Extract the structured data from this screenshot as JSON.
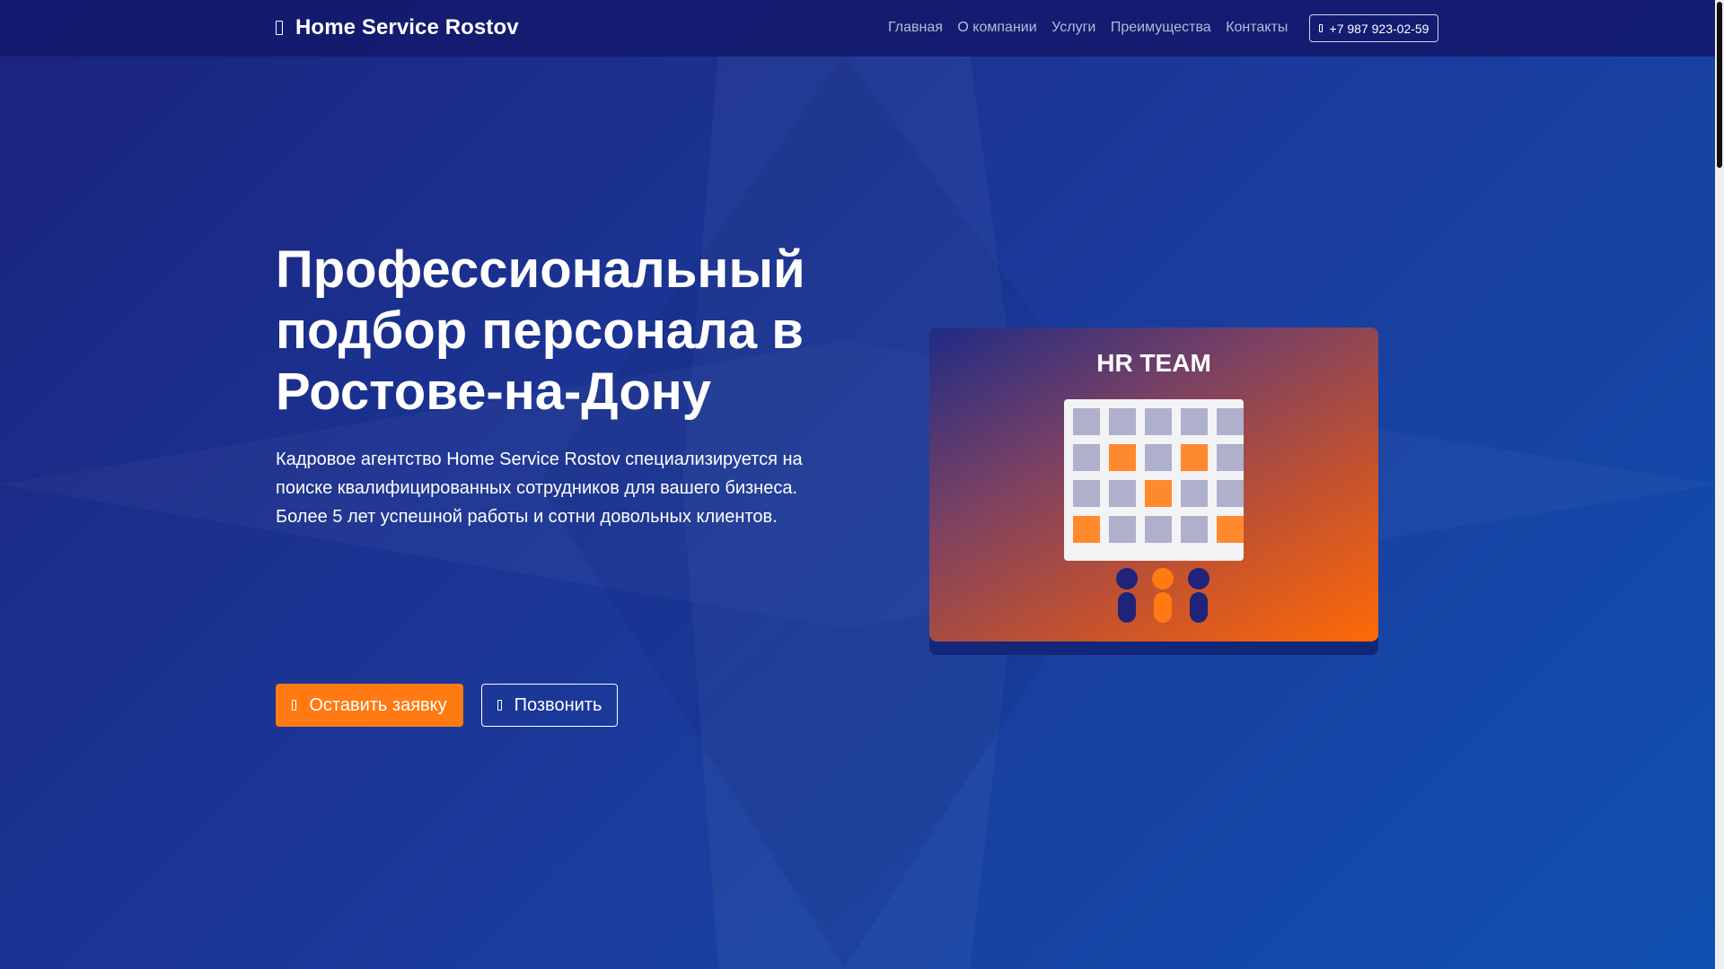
{
  "brand": {
    "name": "Home Service Rostov",
    "icon": "phone-icon"
  },
  "nav": {
    "links": [
      "Главная",
      "О компании",
      "Услуги",
      "Преимущества",
      "Контакты"
    ],
    "phone": "+7 987 923-02-59",
    "phone_icon": "phone-icon"
  },
  "hero": {
    "title": "Профессиональный подбор персонала в Ростове-на-Дону",
    "text": "Кадровое агентство Home Service Rostov специализируется на поиске квалифицированных сотрудников для вашего бизнеса. Более 5 лет успешной работы и сотни довольных клиентов.",
    "buttons": {
      "primary": {
        "label": "Оставить заявку",
        "icon": "document-icon"
      },
      "secondary": {
        "label": "Позвонить",
        "icon": "phone-icon"
      }
    }
  },
  "card": {
    "title": "HR TEAM",
    "grid": [
      [
        0,
        0,
        0,
        0,
        0
      ],
      [
        0,
        1,
        0,
        1,
        0
      ],
      [
        0,
        0,
        1,
        0,
        0
      ],
      [
        1,
        0,
        0,
        0,
        1
      ]
    ],
    "people_colors": [
      "#1f237a",
      "#ff7a12",
      "#1f237a"
    ]
  },
  "colors": {
    "accent": "#ff7a12",
    "navbar": "#141a6e",
    "cell_default": "#aeb0cc",
    "cell_highlight": "#ff8a2e"
  }
}
